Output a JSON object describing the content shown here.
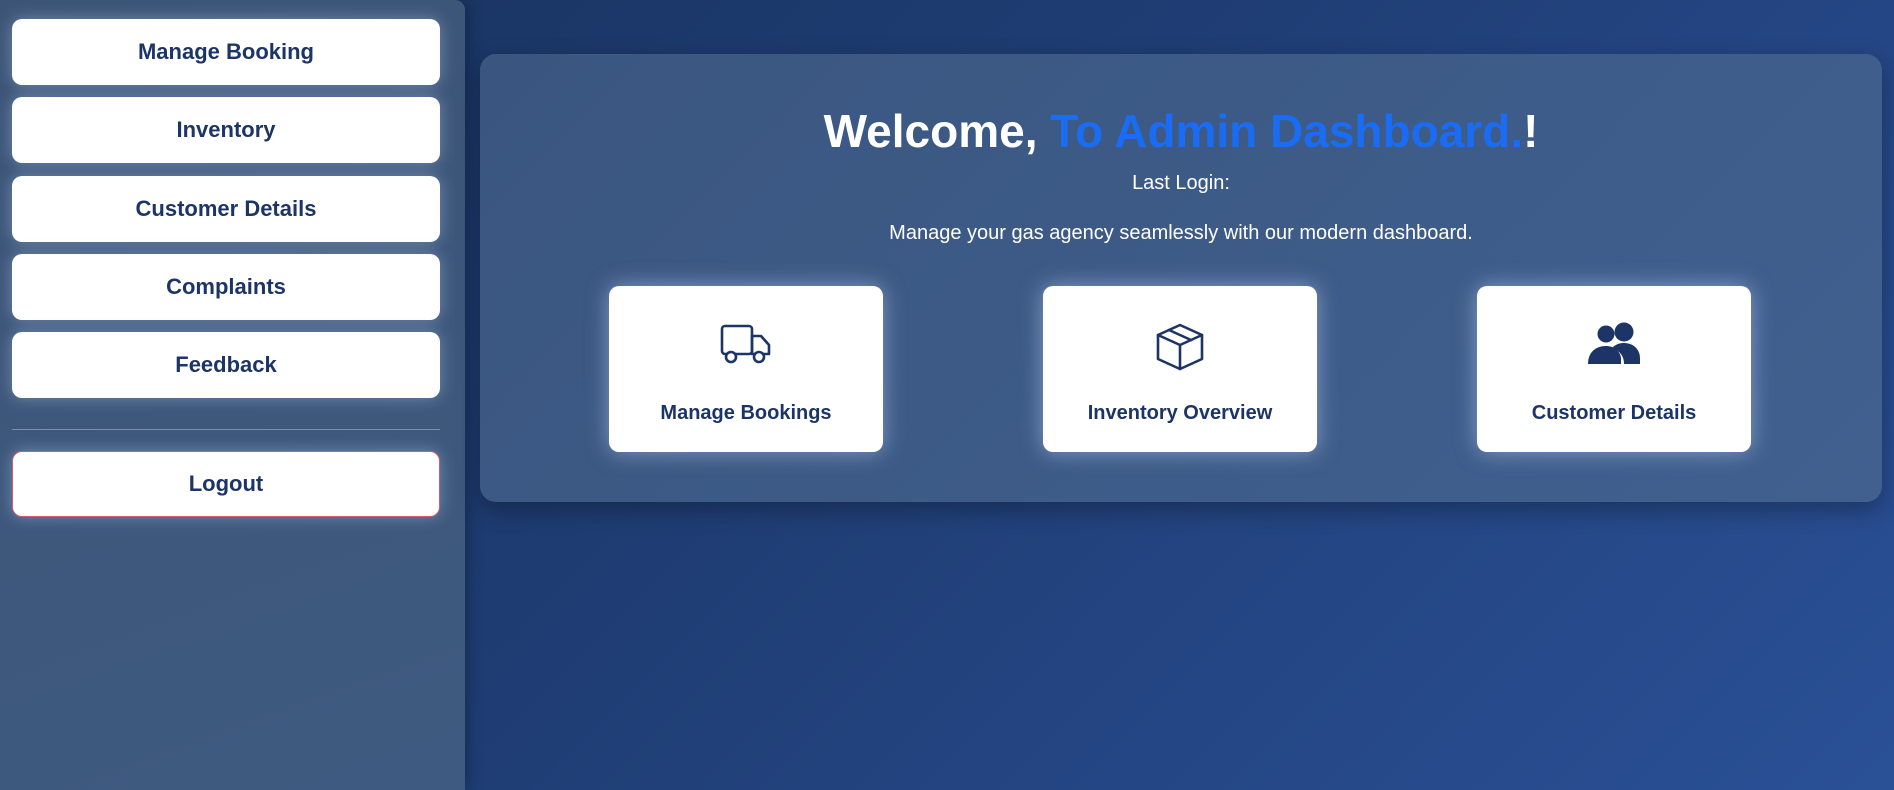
{
  "sidebar": {
    "items": [
      {
        "label": "Manage Booking"
      },
      {
        "label": "Inventory"
      },
      {
        "label": "Customer Details"
      },
      {
        "label": "Complaints"
      },
      {
        "label": "Feedback"
      }
    ],
    "logout_label": "Logout"
  },
  "main": {
    "title_prefix": "Welcome, ",
    "title_accent": "To Admin Dashboard.",
    "title_suffix": "!",
    "last_login_label": "Last Login:",
    "tagline": "Manage your gas agency seamlessly with our modern dashboard.",
    "cards": [
      {
        "label": "Manage Bookings",
        "icon": "truck-icon"
      },
      {
        "label": "Inventory Overview",
        "icon": "box-icon"
      },
      {
        "label": "Customer Details",
        "icon": "users-icon"
      }
    ]
  },
  "colors": {
    "accent": "#1a6cf2",
    "primary_text": "#1c3566",
    "logout_border": "#d05a78"
  }
}
